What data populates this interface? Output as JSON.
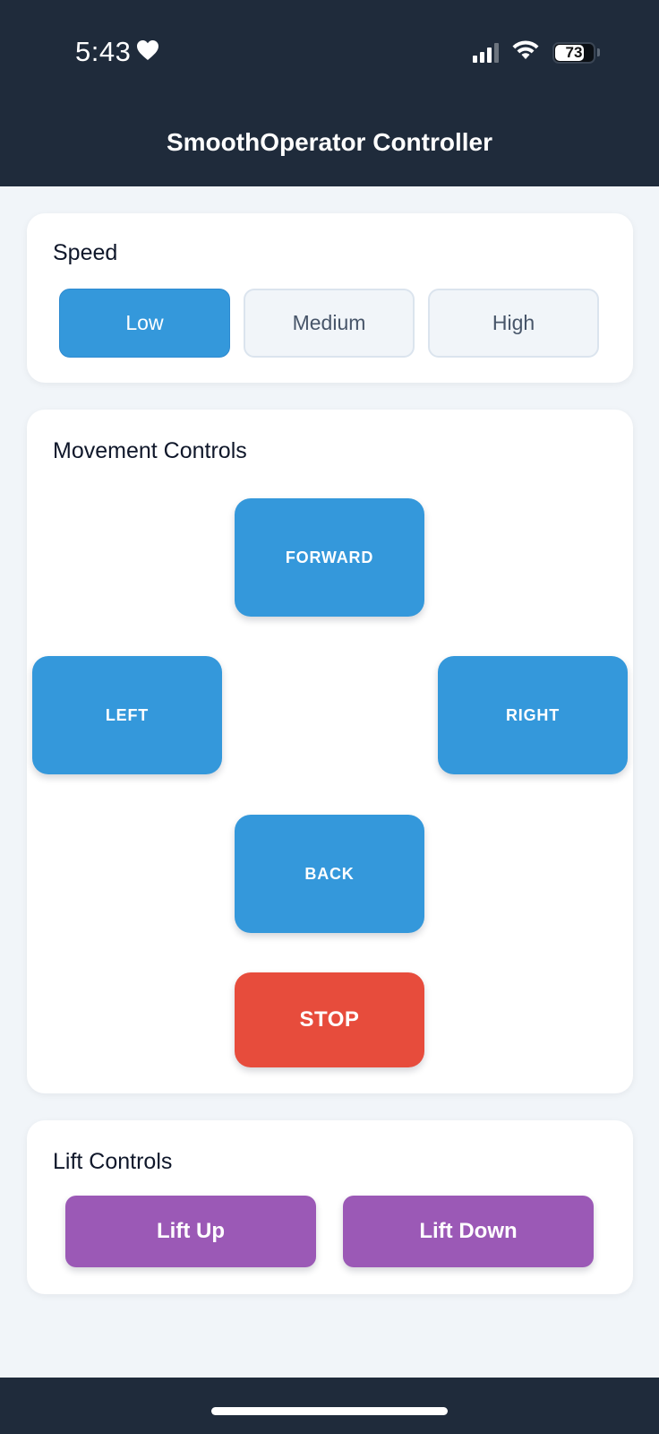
{
  "status_bar": {
    "time": "5:43",
    "battery": "73"
  },
  "header": {
    "title": "SmoothOperator Controller"
  },
  "speed": {
    "title": "Speed",
    "options": [
      "Low",
      "Medium",
      "High"
    ],
    "selected": "Low"
  },
  "movement": {
    "title": "Movement Controls",
    "forward_label": "FORWARD",
    "left_label": "LEFT",
    "right_label": "RIGHT",
    "back_label": "BACK",
    "stop_label": "STOP"
  },
  "lift": {
    "title": "Lift Controls",
    "up_label": "Lift Up",
    "down_label": "Lift Down"
  },
  "colors": {
    "header_bg": "#1f2b3b",
    "page_bg": "#f1f5f9",
    "primary_blue": "#3498db",
    "stop_red": "#e74c3c",
    "lift_purple": "#9b59b6"
  },
  "icons": [
    "heart-icon",
    "signal-icon",
    "wifi-icon",
    "battery-icon"
  ]
}
